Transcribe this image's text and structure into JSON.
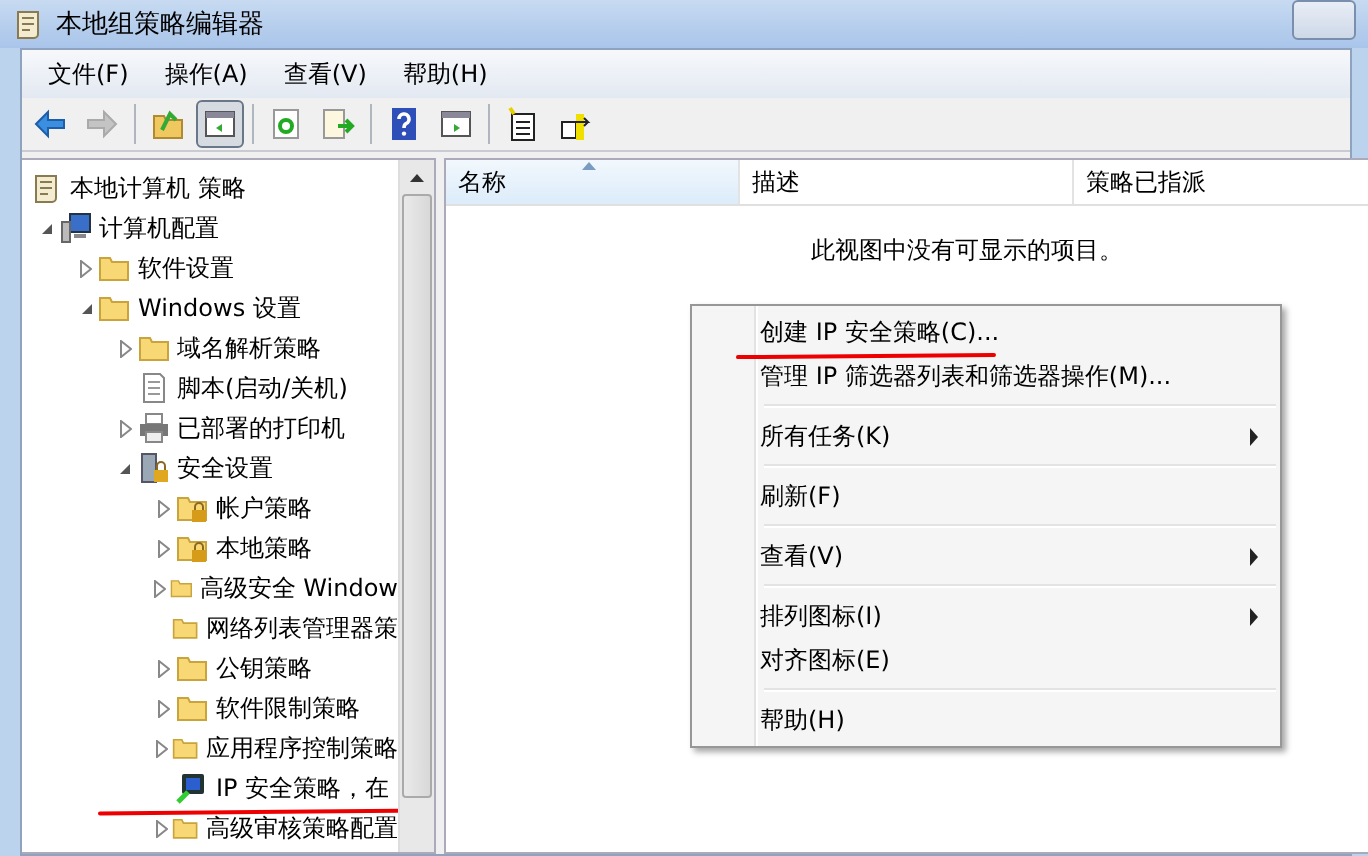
{
  "window": {
    "title": "本地组策略编辑器"
  },
  "menu_bar": [
    {
      "label": "文件(F)"
    },
    {
      "label": "操作(A)"
    },
    {
      "label": "查看(V)"
    },
    {
      "label": "帮助(H)"
    }
  ],
  "toolbar": [
    {
      "kind": "back",
      "disabled": false,
      "pressed": false
    },
    {
      "kind": "forward",
      "disabled": true,
      "pressed": false
    },
    {
      "kind": "sep"
    },
    {
      "kind": "up",
      "disabled": false,
      "pressed": false
    },
    {
      "kind": "tree",
      "disabled": false,
      "pressed": true
    },
    {
      "kind": "sep"
    },
    {
      "kind": "refresh",
      "disabled": false,
      "pressed": false
    },
    {
      "kind": "export",
      "disabled": false,
      "pressed": false
    },
    {
      "kind": "sep"
    },
    {
      "kind": "help",
      "disabled": false,
      "pressed": false
    },
    {
      "kind": "pane",
      "disabled": false,
      "pressed": false
    },
    {
      "kind": "sep"
    },
    {
      "kind": "new",
      "disabled": false,
      "pressed": false
    },
    {
      "kind": "assign",
      "disabled": false,
      "pressed": false
    }
  ],
  "tree": [
    {
      "label": "本地计算机 策略",
      "kind": "policy",
      "marked": false,
      "children": [
        {
          "label": "计算机配置",
          "kind": "computer",
          "expanded": true,
          "marked": false,
          "children": [
            {
              "label": "软件设置",
              "kind": "folder",
              "expanded": false,
              "marked": false
            },
            {
              "label": "Windows 设置",
              "kind": "folder",
              "expanded": true,
              "marked": false,
              "children": [
                {
                  "label": "域名解析策略",
                  "kind": "folder",
                  "expanded": false,
                  "marked": false
                },
                {
                  "label": "脚本(启动/关机)",
                  "kind": "script",
                  "marked": false
                },
                {
                  "label": "已部署的打印机",
                  "kind": "printer",
                  "expanded": false,
                  "marked": false
                },
                {
                  "label": "安全设置",
                  "kind": "security",
                  "expanded": true,
                  "marked": false,
                  "children": [
                    {
                      "label": "帐户策略",
                      "kind": "locked-folder",
                      "expanded": false,
                      "marked": false
                    },
                    {
                      "label": "本地策略",
                      "kind": "locked-folder",
                      "expanded": false,
                      "marked": false
                    },
                    {
                      "label": "高级安全 Window",
                      "kind": "folder",
                      "expanded": false,
                      "marked": false
                    },
                    {
                      "label": "网络列表管理器策",
                      "kind": "folder",
                      "marked": false
                    },
                    {
                      "label": "公钥策略",
                      "kind": "folder",
                      "expanded": false,
                      "marked": false
                    },
                    {
                      "label": "软件限制策略",
                      "kind": "folder",
                      "expanded": false,
                      "marked": false
                    },
                    {
                      "label": "应用程序控制策略",
                      "kind": "folder",
                      "expanded": false,
                      "marked": false
                    },
                    {
                      "label": "IP 安全策略，在",
                      "kind": "ip",
                      "marked": true
                    },
                    {
                      "label": "高级审核策略配置",
                      "kind": "folder",
                      "expanded": false,
                      "marked": false
                    }
                  ]
                }
              ]
            }
          ]
        }
      ]
    }
  ],
  "table": {
    "columns": [
      {
        "label": "名称",
        "sorted": true
      },
      {
        "label": "描述",
        "sorted": false
      },
      {
        "label": "策略已指派",
        "sorted": false
      }
    ],
    "empty_message": "此视图中没有可显示的项目。"
  },
  "context_menu": [
    {
      "kind": "item",
      "label": "创建 IP 安全策略(C)...",
      "submenu": false,
      "marked": true
    },
    {
      "kind": "item",
      "label": "管理 IP 筛选器列表和筛选器操作(M)...",
      "submenu": false,
      "marked": false
    },
    {
      "kind": "separator"
    },
    {
      "kind": "item",
      "label": "所有任务(K)",
      "submenu": true,
      "marked": false
    },
    {
      "kind": "separator"
    },
    {
      "kind": "item",
      "label": "刷新(F)",
      "submenu": false,
      "marked": false
    },
    {
      "kind": "separator"
    },
    {
      "kind": "item",
      "label": "查看(V)",
      "submenu": true,
      "marked": false
    },
    {
      "kind": "separator"
    },
    {
      "kind": "item",
      "label": "排列图标(I)",
      "submenu": true,
      "marked": false
    },
    {
      "kind": "item",
      "label": "对齐图标(E)",
      "submenu": false,
      "marked": false
    },
    {
      "kind": "separator"
    },
    {
      "kind": "item",
      "label": "帮助(H)",
      "submenu": false,
      "marked": false
    }
  ]
}
